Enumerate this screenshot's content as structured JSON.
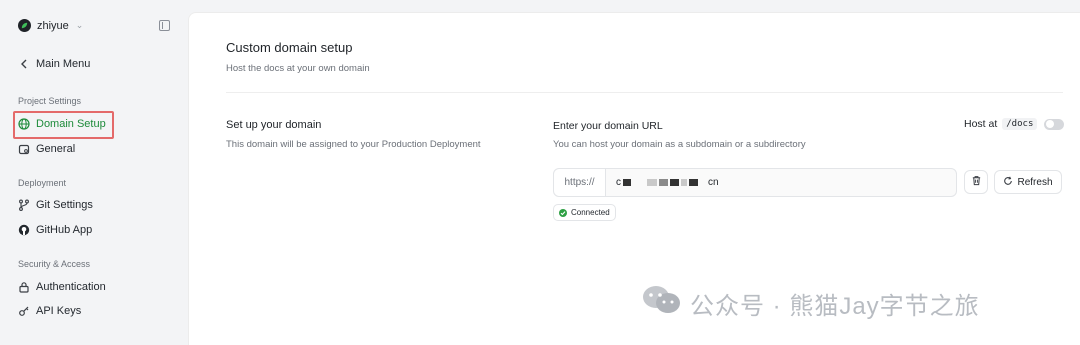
{
  "org": {
    "name": "zhiyue",
    "logo_icon": "leaf-logo-icon"
  },
  "sidebar": {
    "main_menu": "Main Menu",
    "sections": [
      {
        "label": "Project Settings",
        "items": [
          {
            "label": "Domain Setup",
            "icon": "globe-icon",
            "active": true
          },
          {
            "label": "General",
            "icon": "gear-icon"
          }
        ]
      },
      {
        "label": "Deployment",
        "items": [
          {
            "label": "Git Settings",
            "icon": "git-branch-icon"
          },
          {
            "label": "GitHub App",
            "icon": "github-icon"
          }
        ]
      },
      {
        "label": "Security & Access",
        "items": [
          {
            "label": "Authentication",
            "icon": "lock-icon"
          },
          {
            "label": "API Keys",
            "icon": "key-icon"
          }
        ]
      }
    ]
  },
  "main": {
    "title": "Custom domain setup",
    "subtitle": "Host the docs at your own domain",
    "setup": {
      "title": "Set up your domain",
      "subtitle": "This domain will be assigned to your Production Deployment"
    },
    "domain": {
      "title": "Enter your domain URL",
      "subtitle": "You can host your domain as a subdomain or a subdirectory",
      "host_at_label": "Host at",
      "host_at_path": "/docs",
      "host_at_enabled": false,
      "url_prefix": "https://",
      "url_value_start": "c",
      "url_value_end": "cn",
      "refresh_label": "Refresh",
      "status": "Connected"
    }
  },
  "watermark": "公众号 · 熊猫Jay字节之旅",
  "colors": {
    "accent": "#1d8b3a",
    "highlight_box": "#e46a6a",
    "status_ok": "#2ea043"
  }
}
